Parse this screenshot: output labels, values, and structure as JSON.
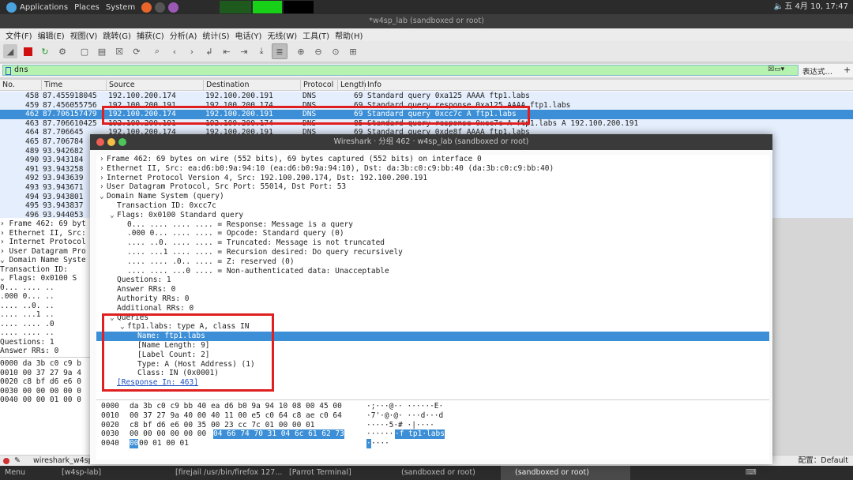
{
  "system_bar": {
    "applications": "Applications",
    "places": "Places",
    "system": "System",
    "clock": "五 4月 10, 17:47"
  },
  "window_title": "*w4sp_lab (sandboxed or root)",
  "menu": [
    "文件(F)",
    "编辑(E)",
    "视图(V)",
    "跳转(G)",
    "捕获(C)",
    "分析(A)",
    "统计(S)",
    "电话(Y)",
    "无线(W)",
    "工具(T)",
    "帮助(H)"
  ],
  "filter": {
    "value": "dns",
    "expression_label": "表达式…",
    "plus": "+"
  },
  "packet_list": {
    "columns": [
      "No.",
      "Time",
      "Source",
      "Destination",
      "Protocol",
      "Length",
      "Info"
    ],
    "rows": [
      {
        "no": "458",
        "time": "87.455918045",
        "src": "192.100.200.174",
        "dst": "192.100.200.191",
        "proto": "DNS",
        "len": "69",
        "info": "Standard query 0xa125 AAAA ftp1.labs"
      },
      {
        "no": "459",
        "time": "87.456055756",
        "src": "192.100.200.191",
        "dst": "192.100.200.174",
        "proto": "DNS",
        "len": "69",
        "info": "Standard query response 0xa125 AAAA ftp1.labs"
      },
      {
        "no": "462",
        "time": "87.706157479",
        "src": "192.100.200.174",
        "dst": "192.100.200.191",
        "proto": "DNS",
        "len": "69",
        "info": "Standard query 0xcc7c A ftp1.labs"
      },
      {
        "no": "463",
        "time": "87.706610425",
        "src": "192.100.200.191",
        "dst": "192.100.200.174",
        "proto": "DNS",
        "len": "85",
        "info": "Standard query response 0xcc7c A ftp1.labs A 192.100.200.191"
      },
      {
        "no": "464",
        "time": "87.706645",
        "src": "192.100.200.174",
        "dst": "192.100.200.191",
        "proto": "DNS",
        "len": "69",
        "info": "Standard query 0xde8f AAAA ftp1.labs"
      },
      {
        "no": "465",
        "time": "87.706784",
        "src": "",
        "dst": "",
        "proto": "",
        "len": "",
        "info": ""
      },
      {
        "no": "489",
        "time": "93.942682",
        "src": "",
        "dst": "",
        "proto": "",
        "len": "",
        "info": ""
      },
      {
        "no": "490",
        "time": "93.943184",
        "src": "",
        "dst": "",
        "proto": "",
        "len": "",
        "info": ""
      },
      {
        "no": "491",
        "time": "93.943258",
        "src": "",
        "dst": "",
        "proto": "",
        "len": "",
        "info": ""
      },
      {
        "no": "492",
        "time": "93.943639",
        "src": "",
        "dst": "",
        "proto": "",
        "len": "",
        "info": ""
      },
      {
        "no": "493",
        "time": "93.943671",
        "src": "",
        "dst": "",
        "proto": "",
        "len": "",
        "info": ""
      },
      {
        "no": "494",
        "time": "93.943801",
        "src": "",
        "dst": "",
        "proto": "",
        "len": "",
        "info": ""
      },
      {
        "no": "495",
        "time": "93.943837",
        "src": "",
        "dst": "",
        "proto": "",
        "len": "",
        "info": ""
      },
      {
        "no": "496",
        "time": "93.944053",
        "src": "",
        "dst": "",
        "proto": "",
        "len": "",
        "info": ""
      }
    ]
  },
  "bg_details": [
    "› Frame 462: 69 byt",
    "› Ethernet II, Src:",
    "› Internet Protocol",
    "› User Datagram Pro",
    "⌄ Domain Name Syste",
    "    Transaction ID:",
    "  ⌄ Flags: 0x0100 S",
    "      0... .... ..",
    "      .000 0... ..",
    "      .... ..0. ..",
    "      .... ...1 ..",
    "      .... .... .0",
    "      .... .... ..",
    "    Questions: 1",
    "    Answer RRs: 0"
  ],
  "bg_hex": [
    "0000  da 3b c0 c9 b",
    "0010  00 37 27 9a 4",
    "0020  c8 bf d6 e6 0",
    "0030  00 00 00 00 0",
    "0040  00 00 01 00 0"
  ],
  "status": {
    "file": "wireshark_w4sp",
    "profile": "配置：Default"
  },
  "taskbar": {
    "menu": "Menu",
    "t1": "[w4sp-lab]",
    "t2": "[firejail /usr/bin/firefox 127...",
    "t3": "[Parrot Terminal]",
    "t4": "(sandboxed or root)",
    "t5": "(sandboxed or root)"
  },
  "dialog": {
    "title": "Wireshark · 分组 462 · w4sp_lab (sandboxed or root)",
    "tree": [
      {
        "indent": 0,
        "tw": "›",
        "text": "Frame 462: 69 bytes on wire (552 bits), 69 bytes captured (552 bits) on interface 0"
      },
      {
        "indent": 0,
        "tw": "›",
        "text": "Ethernet II, Src: ea:d6:b0:9a:94:10 (ea:d6:b0:9a:94:10), Dst: da:3b:c0:c9:bb:40 (da:3b:c0:c9:bb:40)"
      },
      {
        "indent": 0,
        "tw": "›",
        "text": "Internet Protocol Version 4, Src: 192.100.200.174, Dst: 192.100.200.191"
      },
      {
        "indent": 0,
        "tw": "›",
        "text": "User Datagram Protocol, Src Port: 55014, Dst Port: 53"
      },
      {
        "indent": 0,
        "tw": "⌄",
        "text": "Domain Name System (query)"
      },
      {
        "indent": 1,
        "tw": "",
        "text": "Transaction ID: 0xcc7c"
      },
      {
        "indent": 1,
        "tw": "⌄",
        "text": "Flags: 0x0100 Standard query"
      },
      {
        "indent": 2,
        "tw": "",
        "text": "0... .... .... .... = Response: Message is a query"
      },
      {
        "indent": 2,
        "tw": "",
        "text": ".000 0... .... .... = Opcode: Standard query (0)"
      },
      {
        "indent": 2,
        "tw": "",
        "text": ".... ..0. .... .... = Truncated: Message is not truncated"
      },
      {
        "indent": 2,
        "tw": "",
        "text": ".... ...1 .... .... = Recursion desired: Do query recursively"
      },
      {
        "indent": 2,
        "tw": "",
        "text": ".... .... .0.. .... = Z: reserved (0)"
      },
      {
        "indent": 2,
        "tw": "",
        "text": ".... .... ...0 .... = Non-authenticated data: Unacceptable"
      },
      {
        "indent": 1,
        "tw": "",
        "text": "Questions: 1"
      },
      {
        "indent": 1,
        "tw": "",
        "text": "Answer RRs: 0"
      },
      {
        "indent": 1,
        "tw": "",
        "text": "Authority RRs: 0"
      },
      {
        "indent": 1,
        "tw": "",
        "text": "Additional RRs: 0"
      },
      {
        "indent": 1,
        "tw": "⌄",
        "text": "Queries"
      },
      {
        "indent": 2,
        "tw": "⌄",
        "text": "ftp1.labs: type A, class IN"
      },
      {
        "indent": 3,
        "tw": "",
        "text": "Name: ftp1.labs"
      },
      {
        "indent": 3,
        "tw": "",
        "text": "[Name Length: 9]"
      },
      {
        "indent": 3,
        "tw": "",
        "text": "[Label Count: 2]"
      },
      {
        "indent": 3,
        "tw": "",
        "text": "Type: A (Host Address) (1)"
      },
      {
        "indent": 3,
        "tw": "",
        "text": "Class: IN (0x0001)"
      },
      {
        "indent": 1,
        "tw": "",
        "text": "[Response In: 463]"
      }
    ],
    "hex": [
      {
        "off": "0000",
        "bytes": "da 3b c0 c9 bb 40 ea d6  b0 9a 94 10 08 00 45 00",
        "hlb": "",
        "ascii": "·;···@·· ······E·",
        "hla": ""
      },
      {
        "off": "0010",
        "bytes": "00 37 27 9a 40 00 40 11  00 e5 c0 64 c8 ae c0 64",
        "hlb": "",
        "ascii": "·7'·@·@· ···d···d",
        "hla": ""
      },
      {
        "off": "0020",
        "bytes": "c8 bf d6 e6 00 35 00 23  cc 7c 01 00 00 01",
        "hlb": "",
        "ascii": "·····5·# ·|····",
        "hla": ""
      },
      {
        "off": "0030",
        "bytes": "00 00 00 00 00 00 ",
        "hlb": "04 66  74 70 31 04 6c 61 62 73",
        "ascii": "······",
        "hla": "·f tp1·labs"
      },
      {
        "off": "0040",
        "bytes": "",
        "hlb": "00",
        "bytes2": " 00 01 00 01",
        "ascii": "",
        "hla": "·",
        "ascii2": "····"
      }
    ]
  }
}
